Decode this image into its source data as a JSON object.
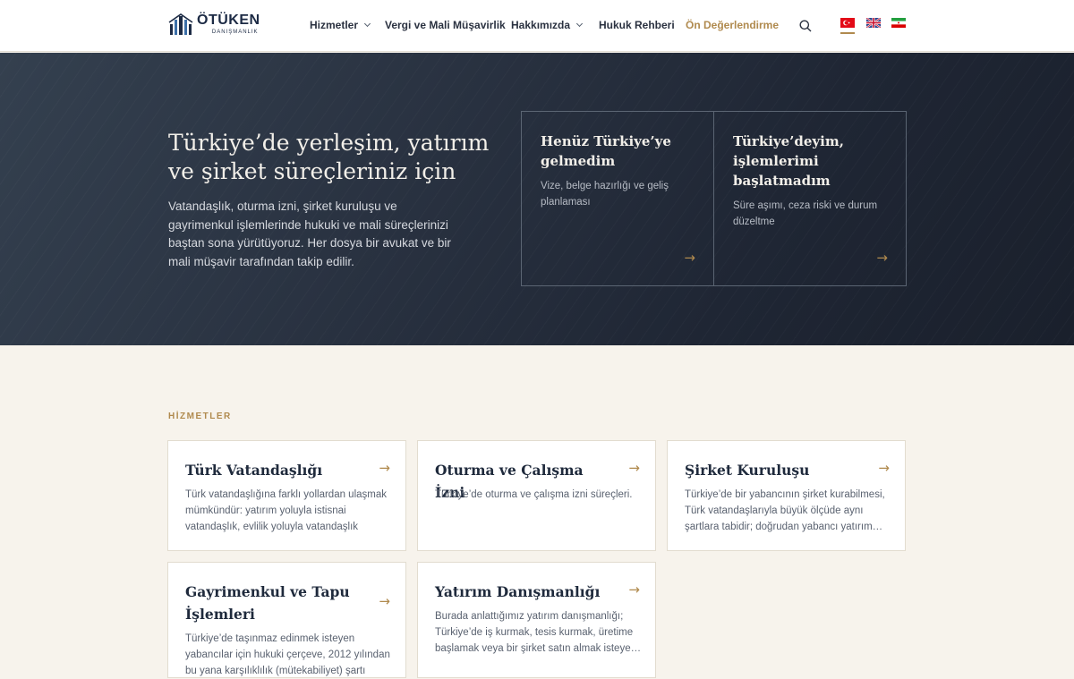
{
  "header": {
    "logo": {
      "name": "ÖTÜKEN",
      "sub": "DANIŞMANLIK"
    },
    "nav": [
      {
        "label": "Hizmetler",
        "dropdown": true
      },
      {
        "label": "Vergi ve Mali Müşavirlik",
        "dropdown": false
      },
      {
        "label": "Hakkımızda",
        "dropdown": true
      },
      {
        "label": "Hukuk Rehberi",
        "dropdown": false
      },
      {
        "label": "Ön Değerlendirme",
        "dropdown": false,
        "accent": true
      }
    ],
    "icons": {
      "search": "search-icon"
    },
    "languages": [
      "tr",
      "en",
      "fa"
    ],
    "active_language": "tr"
  },
  "hero": {
    "title": "Türkiye’de yerleşim, yatırım ve şirket süreçleriniz için",
    "text": "Vatandaşlık, oturma izni, şirket kuruluşu ve gayrimenkul işlemlerinde hukuki ve mali süreçlerinizi baştan sona yürütüyoruz. Her dosya bir avukat ve bir mali müşavir tarafından takip edilir.",
    "cards": [
      {
        "title": "Henüz Türkiye’ye gelmedim",
        "desc": "Vize, belge hazırlığı ve geliş planlaması",
        "arrow": "→"
      },
      {
        "title": "Türkiye’deyim, işlemlerimi başlatmadım",
        "desc": "Süre aşımı, ceza riski ve durum düzeltme",
        "arrow": "→"
      }
    ]
  },
  "services": {
    "label": "HİZMETLER",
    "items": [
      {
        "title": "Türk Vatandaşlığı",
        "desc": "Türk vatandaşlığına farklı yollardan ulaşmak mümkündür: yatırım yoluyla istisnai vatandaşlık, evlilik yoluyla vatandaşlık veya…",
        "arrow": "→"
      },
      {
        "title": "Oturma ve Çalışma İzni",
        "desc": "Türkiye’de oturma ve çalışma izni süreçleri.",
        "arrow": "→"
      },
      {
        "title": "Şirket Kuruluşu",
        "desc": "Türkiye’de bir yabancının şirket kurabilmesi, Türk vatandaşlarıyla büyük ölçüde aynı şartlara tabidir; doğrudan yabancı yatırım…",
        "arrow": "→"
      },
      {
        "title": "Gayrimenkul ve Tapu İşlemleri",
        "desc": "Türkiye’de taşınmaz edinmek isteyen yabancılar için hukuki çerçeve, 2012 yılından bu yana karşılıklılık (mütekabiliyet) şartı",
        "arrow": "→"
      },
      {
        "title": "Yatırım Danışmanlığı",
        "desc": "Burada anlattığımız yatırım danışmanlığı; Türkiye’de iş kurmak, tesis kurmak, üretime başlamak veya bir şirket satın almak isteye…",
        "arrow": "→"
      }
    ]
  },
  "colors": {
    "accent": "#b08a4e",
    "hero_bg": "#222a38",
    "page_bg": "#f7f3ec",
    "navy": "#1c2a44"
  }
}
